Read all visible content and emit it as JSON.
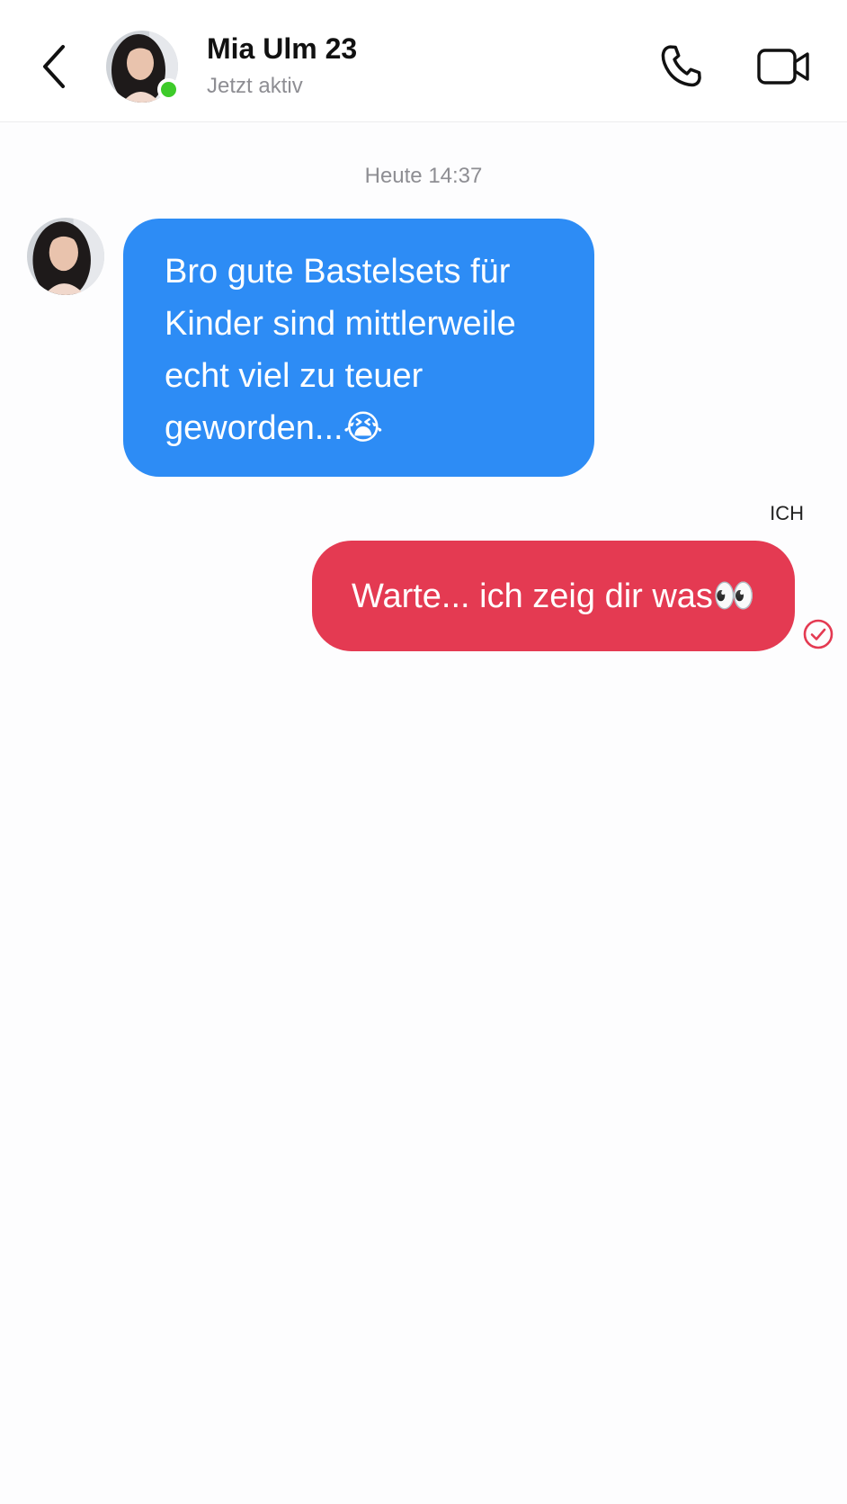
{
  "header": {
    "contact_name": "Mia Ulm 23",
    "status": "Jetzt aktiv",
    "online_color": "#3ecb2a",
    "back_icon": "chevron-left-icon",
    "call_icon": "phone-icon",
    "video_icon": "video-camera-icon"
  },
  "chat": {
    "timestamp": "Heute 14:37",
    "messages": [
      {
        "direction": "incoming",
        "text": "Bro gute Bastelsets für Kinder sind mittlerweile echt viel zu teuer geworden...😭",
        "bubble_color": "#2d8cf5"
      },
      {
        "direction": "outgoing",
        "sender_label": "ICH",
        "text": "Warte... ich zeig dir was👀",
        "bubble_color": "#e43a52",
        "status_icon": "check-circle-icon"
      }
    ]
  }
}
